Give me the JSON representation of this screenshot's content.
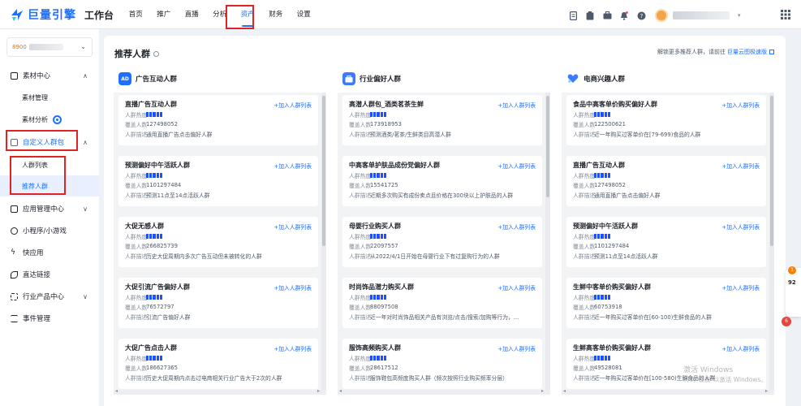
{
  "app": {
    "brand": "巨量引擎",
    "sub": "工作台",
    "nav": [
      "首页",
      "推广",
      "直播",
      "分析",
      "资产",
      "财务",
      "设置"
    ],
    "nav_active": 4,
    "user_caret": "▾"
  },
  "sidebar": {
    "account_tag": "8900",
    "items": [
      {
        "label": "素材中心",
        "icon": "image-icon",
        "caret": "∧"
      },
      {
        "label": "素材管理"
      },
      {
        "label": "素材分析"
      },
      {
        "label": "自定义人群包",
        "icon": "group-icon",
        "caret": "∧"
      },
      {
        "label": "人群列表"
      },
      {
        "label": "推荐人群"
      },
      {
        "label": "应用管理中心",
        "icon": "app-icon",
        "caret": "∨"
      },
      {
        "label": "小程序/小游戏",
        "icon": "miniapp-icon"
      },
      {
        "label": "快应用",
        "icon": "flash-icon"
      },
      {
        "label": "直达链接",
        "icon": "link-icon"
      },
      {
        "label": "行业产品中心",
        "icon": "grid-icon",
        "caret": "∨"
      },
      {
        "label": "事件管理",
        "icon": "event-icon"
      }
    ]
  },
  "main": {
    "title": "推荐人群",
    "hint_prefix": "解锁更多推荐人群，请前往",
    "hint_link": "巨量云图极速版",
    "labels": {
      "heat": "人群热度",
      "cover": "覆盖人数",
      "desc": "人群描述",
      "add": "+加入人群列表"
    },
    "columns": [
      {
        "name": "广告互动人群",
        "icon_text": "AD",
        "color": "#1f6fff",
        "cards": [
          {
            "title": "直播广告互动人群",
            "heat": 5,
            "cover": "127498052",
            "desc": "通用直播广告点击偏好人群"
          },
          {
            "title": "预测偏好中午活跃人群",
            "heat": 5,
            "cover": "1101297484",
            "desc": "预测11点至14点活跃人群"
          },
          {
            "title": "大促无感人群",
            "heat": 5,
            "cover": "266825739",
            "desc": "历史大促周期内多次广告互动但未被转化的人群"
          },
          {
            "title": "大促引流广告偏好人群",
            "heat": 5,
            "cover": "76572797",
            "desc": "引流广告偏好人群"
          },
          {
            "title": "大促广告点击人群",
            "heat": 5,
            "cover": "186627365",
            "desc": "历史大促周期内点击过电商相关行业广告大于2次的人群"
          }
        ]
      },
      {
        "name": "行业偏好人群",
        "icon_text": "",
        "color": "#3e7bfa",
        "cards": [
          {
            "title": "高潜人群包_酒类茗茶生鲜",
            "heat": 5,
            "cover": "173918953",
            "desc": "预测酒类/茗茶/生鲜类目高潜人群"
          },
          {
            "title": "中高客单护肤品成份党偏好人群",
            "heat": 5,
            "cover": "15541725",
            "desc": "近期多次购买有成份卖点且价格在300块以上护肤品的人群"
          },
          {
            "title": "母婴行业购买人群",
            "heat": 5,
            "cover": "22097557",
            "desc": "从2022/4/1日开始在母婴行业下有过复购行为的人群"
          },
          {
            "title": "时尚饰品潜力购买人群",
            "heat": 5,
            "cover": "88097508",
            "desc": "近一年对时尚饰品相关产品有浏览/点击/搜索/加购等行为，..."
          },
          {
            "title": "服饰高频购买人群",
            "heat": 5,
            "cover": "28617512",
            "desc": "服饰鞋包高频度购买人群（频次按照行业购买频率分层）"
          }
        ]
      },
      {
        "name": "电商兴趣人群",
        "icon_text": "",
        "color": "#3e7bfa",
        "cards": [
          {
            "title": "食品中高客单价购买偏好人群",
            "heat": 5,
            "cover": "122500621",
            "desc": "近一年购买过客单价在[79-699)食品的人群"
          },
          {
            "title": "直播广告互动人群",
            "heat": 5,
            "cover": "127498052",
            "desc": "通用直播广告点击偏好人群"
          },
          {
            "title": "预测偏好中午活跃人群",
            "heat": 5,
            "cover": "1101297484",
            "desc": "预测11点至14点活跃人群"
          },
          {
            "title": "生鲜中客单价购买偏好人群",
            "heat": 5,
            "cover": "60753918",
            "desc": "近一年购买过客单价在[60-100)生鲜食品的人群"
          },
          {
            "title": "生鲜高客单价购买偏好人群",
            "heat": 5,
            "cover": "49528081",
            "desc": "近一年购买过客单价在[100-580)生鲜食品的人群"
          }
        ]
      }
    ]
  },
  "float": {
    "badge": "1",
    "num": "92",
    "bubble": "6"
  },
  "watermark": {
    "line1": "激活 Windows",
    "line2": "转到\"设置\"以激活 Windows。"
  }
}
